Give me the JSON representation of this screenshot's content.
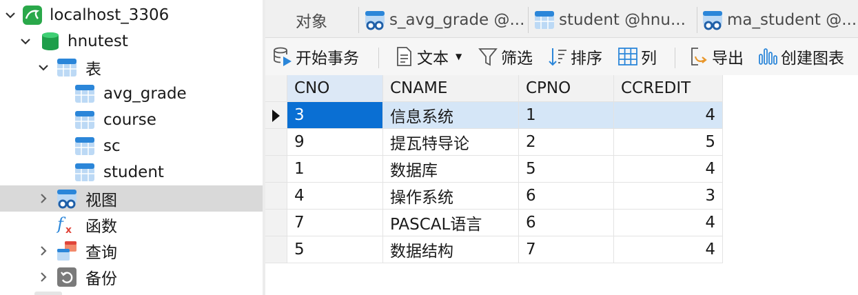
{
  "sidebar": {
    "connection": "localhost_3306",
    "database": "hnutest",
    "tables_folder": "表",
    "tables": [
      "avg_grade",
      "course",
      "sc",
      "student"
    ],
    "views_folder": "视图",
    "functions_folder": "函数",
    "queries_folder": "查询",
    "backups_folder": "备份"
  },
  "tabs": [
    {
      "label": "对象"
    },
    {
      "label": "s_avg_grade @..."
    },
    {
      "label": "student @hnu..."
    },
    {
      "label": "ma_student @..."
    }
  ],
  "toolbar": {
    "begin_transaction": "开始事务",
    "text": "文本",
    "filter": "筛选",
    "sort": "排序",
    "columns": "列",
    "export": "导出",
    "create_chart": "创建图表"
  },
  "grid": {
    "columns": [
      "CNO",
      "CNAME",
      "CPNO",
      "CCREDIT"
    ],
    "rows": [
      [
        "3",
        "信息系统",
        "1",
        "4"
      ],
      [
        "9",
        "提瓦特导论",
        "2",
        "5"
      ],
      [
        "1",
        "数据库",
        "5",
        "4"
      ],
      [
        "4",
        "操作系统",
        "6",
        "3"
      ],
      [
        "7",
        "PASCAL语言",
        "6",
        "4"
      ],
      [
        "5",
        "数据结构",
        "7",
        "4"
      ]
    ]
  },
  "colors": {
    "accent": "#0a6fd3",
    "row_highlight": "#d5e6f7",
    "sidebar_selected": "#d9d9d9",
    "db_green": "#1e9e4a",
    "table_blue": "#2b86d9"
  }
}
